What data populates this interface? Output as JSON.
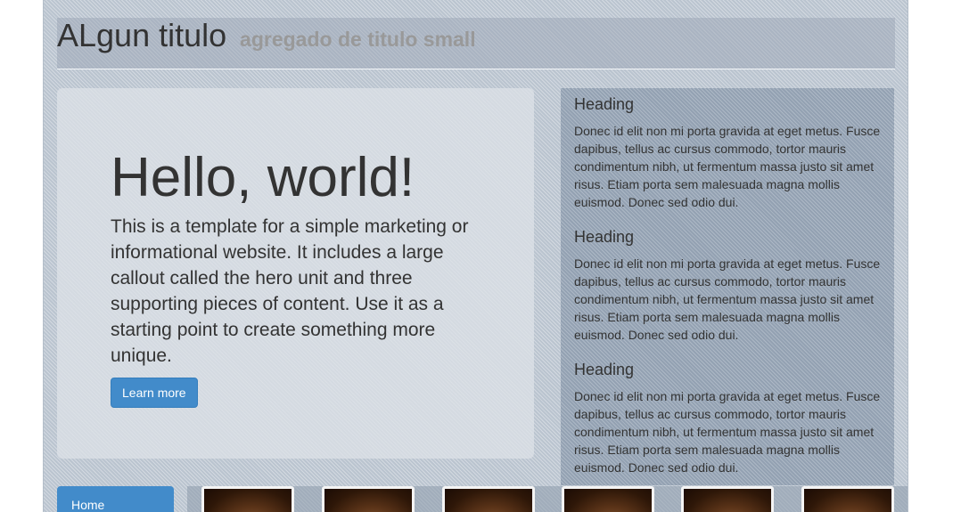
{
  "header": {
    "title": "ALgun titulo",
    "subtitle": "agregado de titulo small"
  },
  "hero": {
    "heading": "Hello, world!",
    "text": "This is a template for a simple marketing or informational website. It includes a large callout called the hero unit and three supporting pieces of content. Use it as a starting point to create something more unique.",
    "button_label": "Learn more"
  },
  "sidebar": {
    "blocks": [
      {
        "heading": "Heading",
        "body": "Donec id elit non mi porta gravida at eget metus. Fusce dapibus, tellus ac cursus commodo, tortor mauris condimentum nibh, ut fermentum massa justo sit amet risus. Etiam porta sem malesuada magna mollis euismod. Donec sed odio dui."
      },
      {
        "heading": "Heading",
        "body": "Donec id elit non mi porta gravida at eget metus. Fusce dapibus, tellus ac cursus commodo, tortor mauris condimentum nibh, ut fermentum massa justo sit amet risus. Etiam porta sem malesuada magna mollis euismod. Donec sed odio dui."
      },
      {
        "heading": "Heading",
        "body": "Donec id elit non mi porta gravida at eget metus. Fusce dapibus, tellus ac cursus commodo, tortor mauris condimentum nibh, ut fermentum massa justo sit amet risus. Etiam porta sem malesuada magna mollis euismod. Donec sed odio dui."
      }
    ]
  },
  "nav": {
    "items": [
      {
        "label": "Home",
        "active": true
      }
    ]
  },
  "gallery": {
    "thumbnails": [
      "thumbnail-image",
      "thumbnail-image",
      "thumbnail-image",
      "thumbnail-image",
      "thumbnail-image",
      "thumbnail-image"
    ]
  },
  "colors": {
    "accent": "#428bca",
    "page_background": "#c2cbd5",
    "text": "#333333",
    "muted_text": "#999999"
  }
}
